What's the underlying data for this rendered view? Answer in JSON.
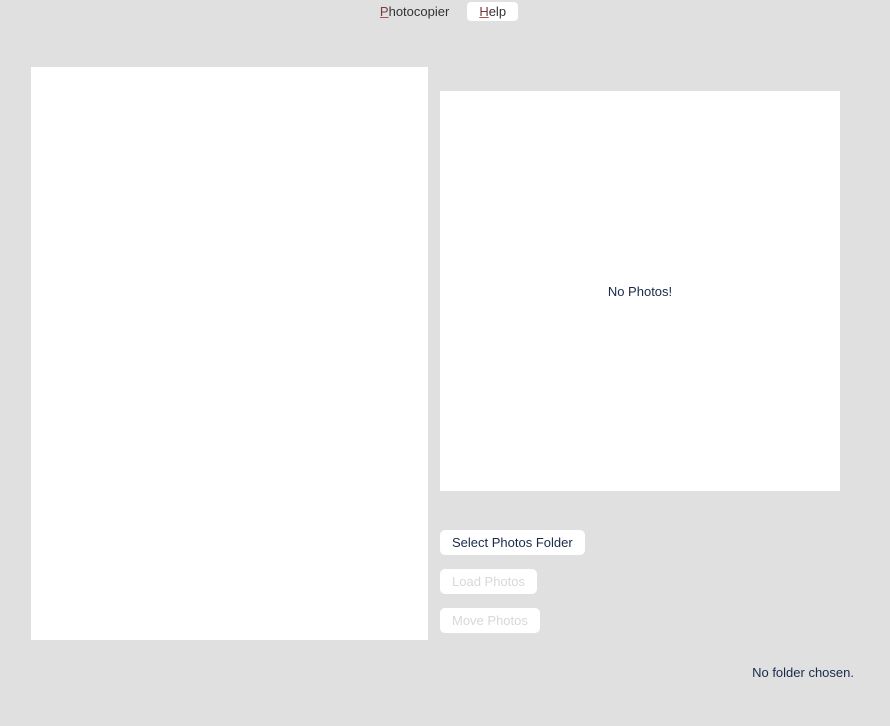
{
  "menubar": {
    "app_name": "Photocopier",
    "help_label": "Help"
  },
  "preview": {
    "empty_message": "No Photos!"
  },
  "controls": {
    "select_folder_label": "Select Photos Folder",
    "load_photos_label": "Load Photos",
    "move_photos_label": "Move Photos"
  },
  "status": {
    "folder_text": "No folder chosen."
  }
}
